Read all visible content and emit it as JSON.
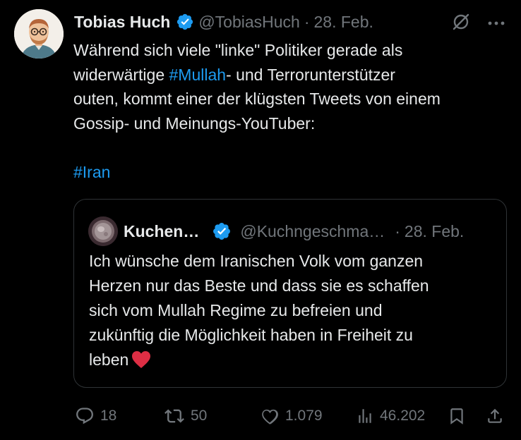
{
  "author": {
    "name": "Tobias Huch",
    "handle": "@TobiasHuch",
    "separator": "·",
    "date": "28. Feb."
  },
  "tweet": {
    "line1": "Während sich viele \"linke\" Politiker gerade als",
    "line2_pre": "widerwärtige ",
    "line2_tag": "#Mullah",
    "line2_post": "- und Terrorunterstützer",
    "line3": "outen, kommt einer der klügsten Tweets von einem",
    "line4": "Gossip- und Meinungs-YouTuber:",
    "hashtag": "#Iran"
  },
  "quote": {
    "name": "Kuchen…",
    "handle": "@Kuchngeschma…",
    "separator": "·",
    "date": "28. Feb.",
    "lines": [
      "Ich wünsche dem Iranischen Volk vom ganzen",
      "Herzen nur das Beste und dass sie es schaffen",
      "sich vom Mullah Regime zu befreien und",
      "zukünftig die Möglichkeit haben in Freiheit zu",
      "leben"
    ]
  },
  "actions": {
    "replies": "18",
    "reposts": "50",
    "likes": "1.079",
    "views": "46.202"
  },
  "colors": {
    "background": "#000000",
    "text": "#e7e9ea",
    "muted": "#71767b",
    "accent": "#1d9bf0",
    "border": "#2f3336",
    "heart": "#e0245e"
  }
}
